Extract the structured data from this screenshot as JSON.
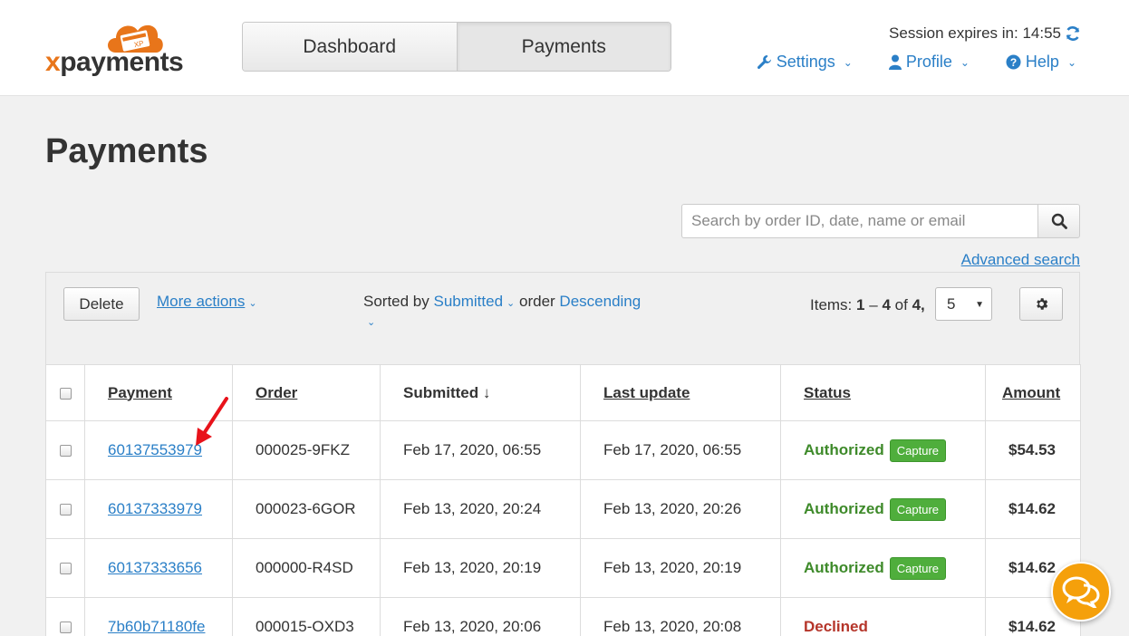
{
  "brand": {
    "logo_x": "x",
    "logo_rest": "payments",
    "logo_badge": "XP"
  },
  "nav": {
    "tabs": [
      {
        "label": "Dashboard"
      },
      {
        "label": "Payments"
      }
    ]
  },
  "session": {
    "text": "Session expires in: 14:55"
  },
  "toplinks": {
    "settings": "Settings",
    "profile": "Profile",
    "help": "Help"
  },
  "page": {
    "title": "Payments"
  },
  "search": {
    "placeholder": "Search by order ID, date, name or email",
    "advanced": "Advanced search"
  },
  "toolbar": {
    "delete": "Delete",
    "more_actions": "More actions",
    "sorted_by_label": "Sorted by",
    "sorted_by_value": "Submitted",
    "order_label": "order",
    "order_value": "Descending",
    "items_label": "Items:",
    "items_from": "1",
    "items_dash": "–",
    "items_to": "4",
    "items_of": "of",
    "items_total": "4,",
    "per_page": "5"
  },
  "table": {
    "headers": {
      "payment": "Payment",
      "order": "Order",
      "submitted": "Submitted ↓",
      "last_update": "Last update",
      "status": "Status",
      "amount": "Amount"
    },
    "rows": [
      {
        "payment": "60137553979",
        "order": "000025-9FKZ",
        "submitted": "Feb 17, 2020, 06:55",
        "last_update": "Feb 17, 2020, 06:55",
        "status": "Authorized",
        "action": "Capture",
        "amount": "$54.53"
      },
      {
        "payment": "60137333979",
        "order": "000023-6GOR",
        "submitted": "Feb 13, 2020, 20:24",
        "last_update": "Feb 13, 2020, 20:26",
        "status": "Authorized",
        "action": "Capture",
        "amount": "$14.62"
      },
      {
        "payment": "60137333656",
        "order": "000000-R4SD",
        "submitted": "Feb 13, 2020, 20:19",
        "last_update": "Feb 13, 2020, 20:19",
        "status": "Authorized",
        "action": "Capture",
        "amount": "$14.62"
      },
      {
        "payment": "7b60b71180fe",
        "order": "000015-OXD3",
        "submitted": "Feb 13, 2020, 20:06",
        "last_update": "Feb 13, 2020, 20:08",
        "status": "Declined",
        "action": "",
        "amount": "$14.62"
      }
    ]
  },
  "colors": {
    "link": "#2a7fc7",
    "authorized": "#3e8a2a",
    "declined": "#b5352a",
    "capture": "#4fae3c",
    "brand_orange": "#e8751a",
    "chat": "#f5a00b",
    "annotation": "#e8121a"
  },
  "icons": {
    "refresh": "refresh-icon",
    "wrench": "wrench-icon",
    "user": "user-icon",
    "help": "question-circle-icon",
    "search": "search-icon",
    "gear": "gear-icon",
    "chat": "chat-bubbles-icon",
    "annotation": "red-arrow-icon"
  }
}
